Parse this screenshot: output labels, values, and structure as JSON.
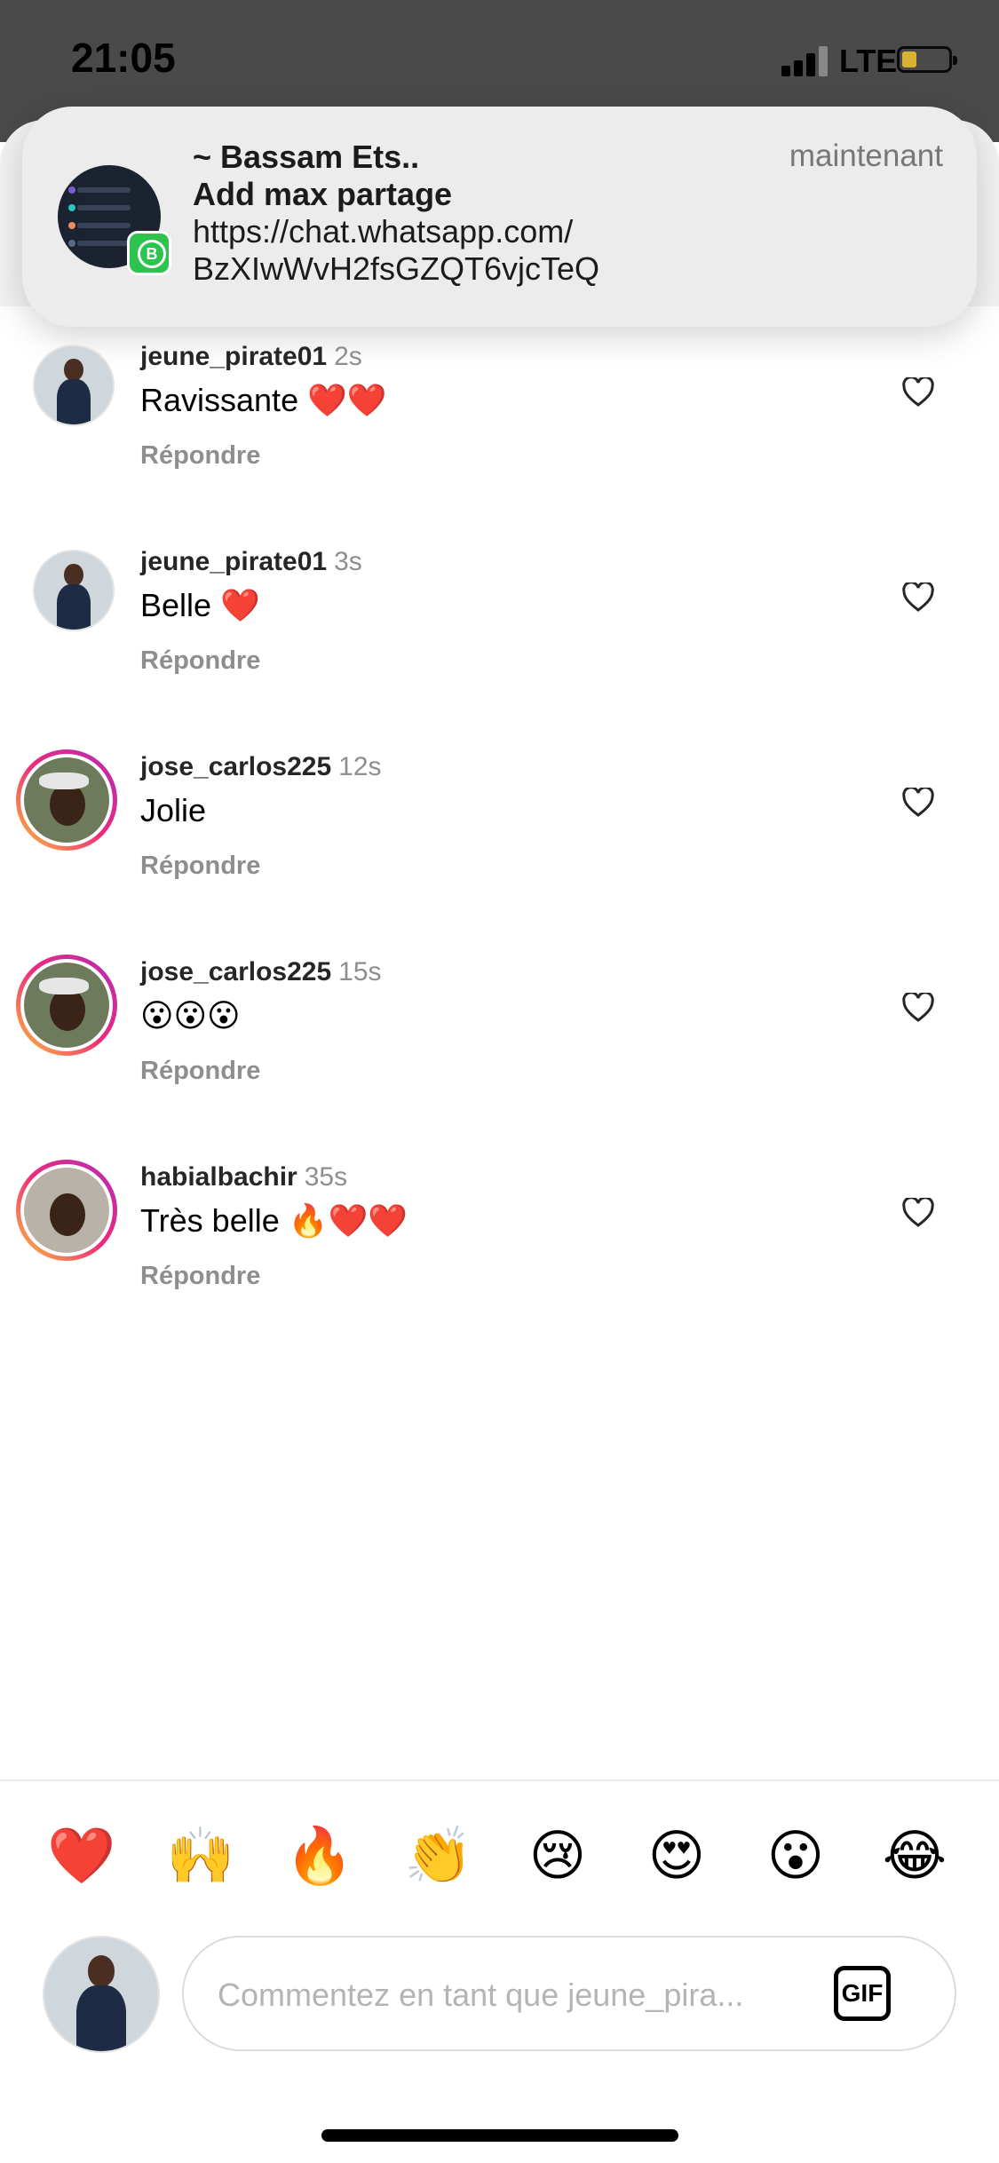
{
  "status_bar": {
    "time": "21:05",
    "network": "LTE"
  },
  "notification": {
    "sender": "~ Bassam Ets..",
    "time": "maintenant",
    "title": "Add max partage",
    "line1": "https://chat.whatsapp.com/",
    "line2": "BzXIwWvH2fsGZQT6vjcTeQ",
    "app_badge": "B"
  },
  "comments": [
    {
      "username": "jeune_pirate01",
      "ago": "2s",
      "text": "Ravissante ❤️❤️",
      "reply": "Répondre"
    },
    {
      "username": "jeune_pirate01",
      "ago": "3s",
      "text": "Belle ❤️",
      "reply": "Répondre"
    },
    {
      "username": "jose_carlos225",
      "ago": "12s",
      "text": "Jolie",
      "reply": "Répondre"
    },
    {
      "username": "jose_carlos225",
      "ago": "15s",
      "text": "😮😮😮",
      "reply": "Répondre"
    },
    {
      "username": "habialbachir",
      "ago": "35s",
      "text": "Très belle 🔥❤️❤️",
      "reply": "Répondre"
    }
  ],
  "quick_reactions": [
    "❤️",
    "🙌",
    "🔥",
    "👏",
    "😢",
    "😍",
    "😮",
    "😂"
  ],
  "composer": {
    "placeholder": "Commentez en tant que jeune_pira...",
    "gif_label": "GIF"
  }
}
